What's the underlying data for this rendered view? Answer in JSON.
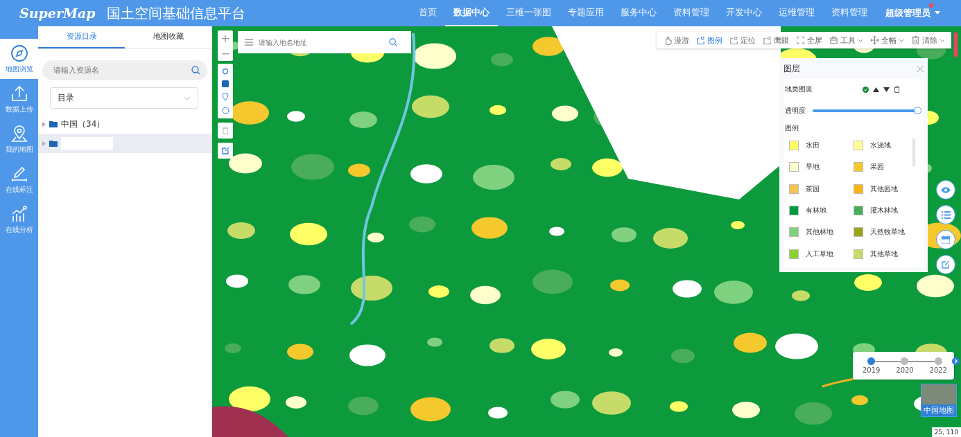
{
  "header": {
    "logo": "SuperMap",
    "title": "国土空间基础信息平台",
    "nav": [
      {
        "label": "首页",
        "selected": false
      },
      {
        "label": "数据中心",
        "selected": true
      },
      {
        "label": "三维一张图",
        "selected": false
      },
      {
        "label": "专题应用",
        "selected": false
      },
      {
        "label": "服务中心",
        "selected": false
      },
      {
        "label": "资料管理",
        "selected": false
      },
      {
        "label": "开发中心",
        "selected": false
      },
      {
        "label": "运维管理",
        "selected": false
      },
      {
        "label": "资料管理",
        "selected": false
      }
    ],
    "user": {
      "name": "超级管理员",
      "notification": true
    }
  },
  "sidebar": {
    "items": [
      {
        "kind": "compass",
        "label": "地图浏览",
        "selected": true
      },
      {
        "kind": "upload",
        "label": "数据上传",
        "selected": false
      },
      {
        "kind": "pin",
        "label": "我的地图",
        "selected": false
      },
      {
        "kind": "pen",
        "label": "在线标注",
        "selected": false
      },
      {
        "kind": "chart",
        "label": "在线分析",
        "selected": false
      }
    ]
  },
  "panel": {
    "tabs": [
      {
        "label": "资源目录",
        "selected": true
      },
      {
        "label": "地图收藏",
        "selected": false
      }
    ],
    "search": {
      "placeholder": "请输入资源名"
    },
    "catalog_select": {
      "value": "目录"
    },
    "tree": [
      {
        "label": "中国（34）",
        "selected": false
      },
      {
        "selected": true
      }
    ]
  },
  "map": {
    "zoom_controls": [
      "+",
      "−"
    ],
    "search": {
      "placeholder": "请输入地名地址"
    },
    "toolbar": [
      {
        "kind": "hand",
        "label": "漫游",
        "selected": false,
        "dropdown": false
      },
      {
        "kind": "frame",
        "label": "图例",
        "selected": true,
        "dropdown": false
      },
      {
        "kind": "frame",
        "label": "定位",
        "selected": false,
        "dropdown": false
      },
      {
        "kind": "frame",
        "label": "鹰眼",
        "selected": false,
        "dropdown": false
      },
      {
        "kind": "expand",
        "label": "全屏",
        "selected": false,
        "dropdown": false
      },
      {
        "kind": "toolbox",
        "label": "工具",
        "selected": false,
        "dropdown": true
      },
      {
        "kind": "move",
        "label": "全幅",
        "selected": false,
        "dropdown": true
      },
      {
        "kind": "trash",
        "label": "清除",
        "selected": false,
        "dropdown": true
      }
    ],
    "layer_panel": {
      "title": "图层",
      "layer": {
        "name": "地类图斑",
        "visible": true
      },
      "opacity": {
        "label": "透明度",
        "level": 1.0
      },
      "legend_title": "图例",
      "legend": [
        {
          "label": "水田",
          "color": "#ffff66"
        },
        {
          "label": "水浇地",
          "color": "#ffff99"
        },
        {
          "label": "旱地",
          "color": "#ffffcc"
        },
        {
          "label": "果园",
          "color": "#f5c82d"
        },
        {
          "label": "茶园",
          "color": "#f7c54e"
        },
        {
          "label": "其他园地",
          "color": "#fbb416"
        },
        {
          "label": "有林地",
          "color": "#009a3e"
        },
        {
          "label": "灌木林地",
          "color": "#4aad5b"
        },
        {
          "label": "其他林地",
          "color": "#7fd17f"
        },
        {
          "label": "天然牧草地",
          "color": "#9aa61a"
        },
        {
          "label": "人工草地",
          "color": "#8dcf2d"
        },
        {
          "label": "其他草地",
          "color": "#c7dc68"
        }
      ]
    },
    "timeline": [
      {
        "year": "2019",
        "selected": true
      },
      {
        "year": "2020",
        "selected": false
      },
      {
        "year": "2022",
        "selected": false
      }
    ],
    "basemap": {
      "label": "中国地图"
    },
    "coordinates": "25, 110"
  }
}
